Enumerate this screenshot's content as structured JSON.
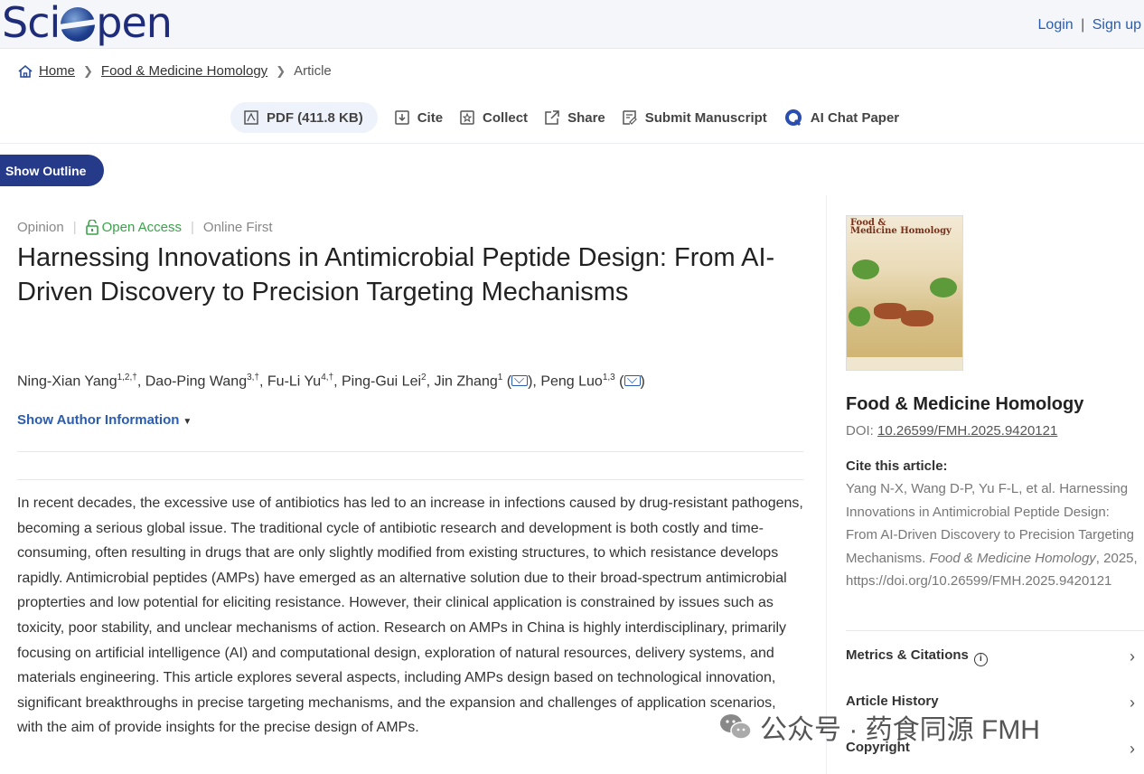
{
  "header": {
    "logo_text_left": "Sci",
    "logo_text_right": "pen",
    "login": "Login",
    "separator": "|",
    "signup": "Sign up"
  },
  "breadcrumb": {
    "home": "Home",
    "journal": "Food & Medicine Homology",
    "current": "Article"
  },
  "toolbar": {
    "pdf": "PDF (411.8 KB)",
    "cite": "Cite",
    "collect": "Collect",
    "share": "Share",
    "submit": "Submit Manuscript",
    "ai_chat": "AI Chat Paper"
  },
  "outline_button": "Show Outline",
  "article": {
    "type": "Opinion",
    "access": "Open Access",
    "status": "Online First",
    "title": "Harnessing Innovations in Antimicrobial Peptide Design: From AI-Driven Discovery to Precision Targeting Mechanisms",
    "authors": [
      {
        "name": "Ning-Xian Yang",
        "sup": "1,2,†"
      },
      {
        "name": "Dao-Ping Wang",
        "sup": "3,†"
      },
      {
        "name": "Fu-Li Yu",
        "sup": "4,†"
      },
      {
        "name": "Ping-Gui Lei",
        "sup": "2"
      },
      {
        "name": "Jin Zhang",
        "sup": "1"
      },
      {
        "name": "Peng Luo",
        "sup": "1,3"
      }
    ],
    "show_author_info": "Show Author Information",
    "abstract": "In recent decades, the excessive use of antibiotics has led to an increase in infections caused by drug-resistant pathogens, becoming a serious global issue. The traditional cycle of antibiotic research and development is both costly and time-consuming, often resulting in drugs that are only slightly modified from existing structures, to which resistance develops rapidly. Antimicrobial peptides (AMPs) have emerged as an alternative solution due to their broad-spectrum antimicrobial propterties and low potential for eliciting resistance. However, their clinical application is constrained by issues such as toxicity, poor stability, and unclear mechanisms of action. Research on AMPs in China is highly interdisciplinary, primarily focusing on artificial intelligence (AI) and computational design, exploration of natural resources, delivery systems, and materials engineering. This article explores several aspects, including AMPs design based on technological innovation, significant breakthroughs in precise targeting mechanisms, and the expansion and challenges of application scenarios, with the aim of provide insights for the precise design of AMPs."
  },
  "sidebar": {
    "cover_title_1": "Food &",
    "cover_title_2": "Medicine Homology",
    "journal_name": "Food & Medicine Homology",
    "doi_label": "DOI:",
    "doi_value": "10.26599/FMH.2025.9420121",
    "cite_heading": "Cite this article:",
    "cite_part1": "Yang N-X, Wang D-P, Yu F-L, et al. Harnessing Innovations in Antimicrobial Peptide Design: From AI-Driven Discovery to Precision Targeting Mechanisms.",
    "cite_journal": "Food & Medicine Homology",
    "cite_part2": ", 2025, https://doi.org/10.26599/FMH.2025.9420121",
    "metrics": "Metrics & Citations",
    "history": "Article History",
    "copyright": "Copyright"
  },
  "watermark": {
    "text": "公众号 · 药食同源 FMH"
  }
}
